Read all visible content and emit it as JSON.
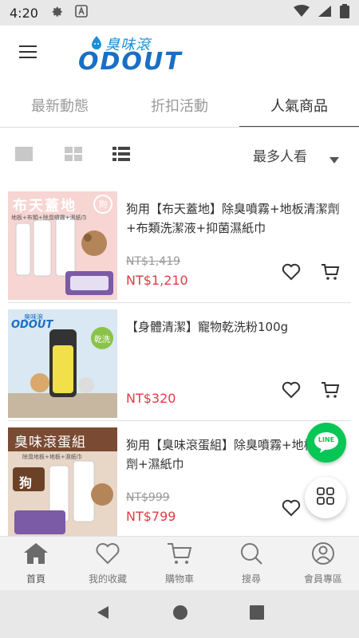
{
  "status_bar": {
    "time": "4:20"
  },
  "header": {
    "logo_cn": "臭味滾",
    "logo_en": "ODOUT"
  },
  "tabs": [
    {
      "label": "最新動態"
    },
    {
      "label": "折扣活動"
    },
    {
      "label": "人氣商品",
      "active": true
    }
  ],
  "toolbar": {
    "sort_label": "最多人看"
  },
  "products": [
    {
      "title": "狗用【布天蓋地】除臭噴霧+地板清潔劑+布類洗潔液+抑菌濕紙巾",
      "old_price": "NT$1,419",
      "price": "NT$1,210",
      "thumb_title": "布天蓋地",
      "thumb_badge": "狗",
      "thumb_sub": "地板+布類+除臭噴霧+濕紙巾"
    },
    {
      "title": "【身體清潔】寵物乾洗粉100g",
      "old_price": "",
      "price": "NT$320",
      "thumb_logo_cn": "臭味滾",
      "thumb_logo_en": "ODOUT",
      "thumb_badge": "乾洗"
    },
    {
      "title": "狗用【臭味滾蛋組】除臭噴霧+地板清潔劑+濕紙巾",
      "old_price": "NT$999",
      "price": "NT$799",
      "thumb_title": "臭味滾蛋組",
      "thumb_badge": "狗",
      "thumb_sub": "除臭地板+地板+濕紙巾"
    }
  ],
  "bottom_nav": [
    {
      "label": "首頁",
      "icon": "home-icon"
    },
    {
      "label": "我的收藏",
      "icon": "heart-icon"
    },
    {
      "label": "購物車",
      "icon": "cart-icon"
    },
    {
      "label": "搜尋",
      "icon": "search-icon"
    },
    {
      "label": "會員專區",
      "icon": "user-icon"
    }
  ],
  "fab": {
    "line_label": "LINE"
  },
  "colors": {
    "price": "#e63946",
    "brand": "#1a6fc4",
    "line": "#06c755"
  }
}
